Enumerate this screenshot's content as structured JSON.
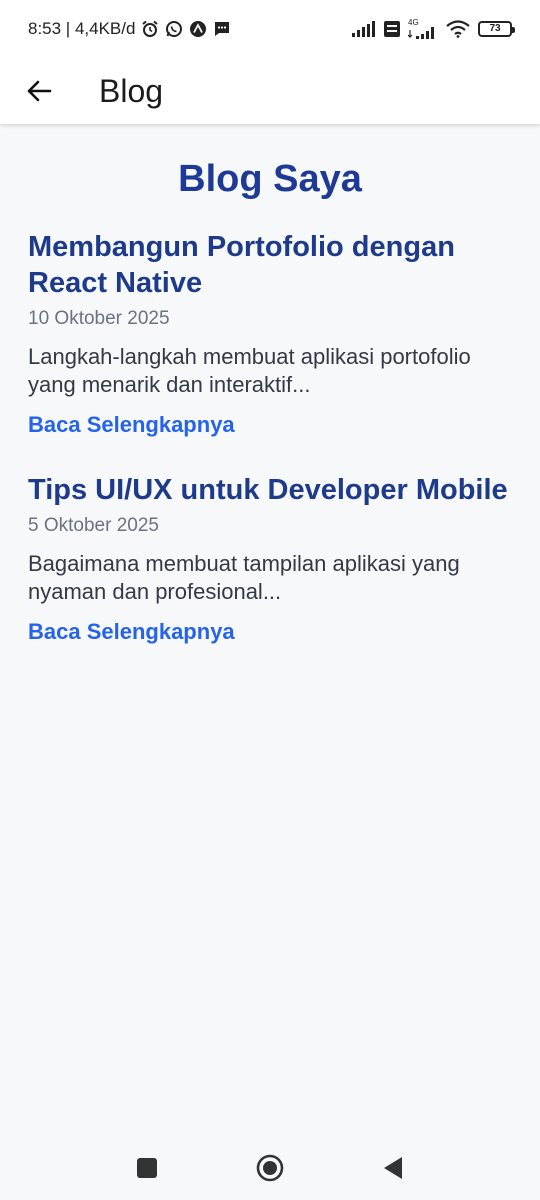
{
  "status_bar": {
    "time_speed": "8:53 | 4,4KB/d",
    "network_4g": "4G",
    "battery_level": "73"
  },
  "app_bar": {
    "title": "Blog"
  },
  "main": {
    "heading": "Blog Saya",
    "posts": [
      {
        "title": "Membangun Portofolio dengan React Native",
        "date": "10 Oktober 2025",
        "excerpt": "Langkah-langkah membuat aplikasi portofolio yang menarik dan interaktif...",
        "link": "Baca Selengkapnya"
      },
      {
        "title": "Tips UI/UX untuk Developer Mobile",
        "date": "5 Oktober 2025",
        "excerpt": "Bagaimana membuat tampilan aplikasi yang nyaman dan profesional...",
        "link": "Baca Selengkapnya"
      }
    ]
  },
  "colors": {
    "heading": "#1e3a96",
    "post_title": "#1e3a8a",
    "link": "#2563eb",
    "date": "#6b7280",
    "background": "#f7f8fa"
  },
  "icons": {
    "status_left": [
      "alarm-icon",
      "whatsapp-icon",
      "app-notification-icon",
      "message-icon"
    ],
    "status_right": [
      "signal-icon",
      "volte-icon",
      "signal-4g-icon",
      "wifi-icon",
      "battery-icon"
    ],
    "navigation": [
      "recents-icon",
      "home-icon",
      "back-icon"
    ]
  }
}
